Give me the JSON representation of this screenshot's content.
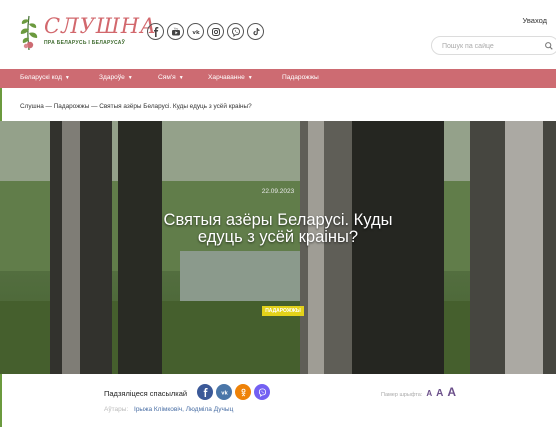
{
  "header": {
    "logo_title": "СЛУШНА",
    "logo_subtitle": "ПРА БЕЛАРУСЬ І БЕЛАРУСАЎ",
    "login_label": "Уваход",
    "search_placeholder": "Пошук па сайце",
    "social_icons": [
      "facebook-icon",
      "youtube-icon",
      "vk-icon",
      "instagram-icon",
      "viber-icon",
      "tiktok-icon"
    ]
  },
  "nav": {
    "items": [
      {
        "label": "Беларускі код",
        "caret": "▼"
      },
      {
        "label": "Здароўе",
        "caret": "▼"
      },
      {
        "label": "Сям'я",
        "caret": "▼"
      },
      {
        "label": "Харчаванне",
        "caret": "▼"
      },
      {
        "label": "Падарожжы",
        "caret": ""
      }
    ]
  },
  "breadcrumb": "Слушна — Падарожжы — Святыя азёры Беларусі. Куды едуць з усёй краіны?",
  "article": {
    "date": "22.09.2023",
    "title": "Святыя азёры Беларусі. Куды едуць з усёй краіны?",
    "tag": "ПАДАРОЖЖЫ"
  },
  "share": {
    "label": "Падзяліцеся спасылкай",
    "buttons": [
      {
        "icon": "facebook-icon",
        "color": "#3b5998"
      },
      {
        "icon": "vk-icon",
        "color": "#4a76a8"
      },
      {
        "icon": "odnoklassniki-icon",
        "color": "#ee8208"
      },
      {
        "icon": "viber-icon",
        "color": "#7360f2"
      }
    ]
  },
  "font_size": {
    "label": "Памер шрыфта:",
    "small": "A",
    "medium": "A",
    "large": "A"
  },
  "authors": {
    "label": "Аўтары:",
    "names": "Ірыжа Клімковіч,   Людміла Дучыц"
  },
  "colors": {
    "brand_pink": "#cd6b72",
    "brand_green": "#6b9a3e",
    "tag_yellow": "#e3d21a"
  }
}
